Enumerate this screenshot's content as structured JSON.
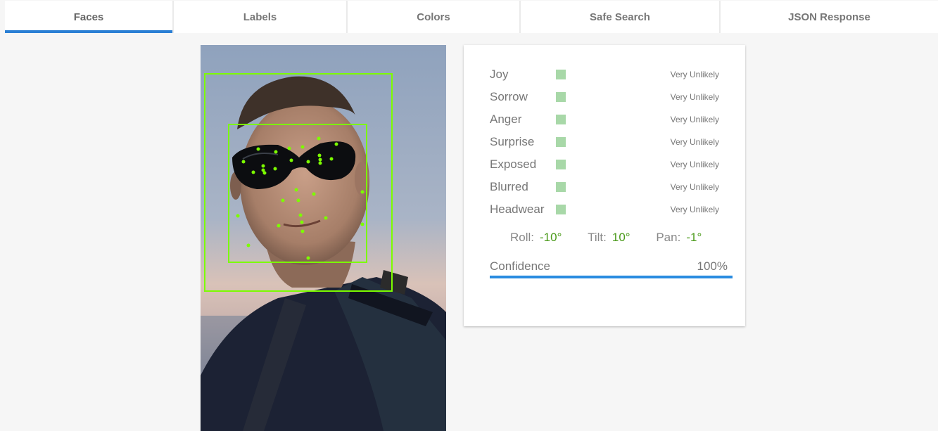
{
  "tabs": [
    {
      "label": "Faces",
      "active": true
    },
    {
      "label": "Labels",
      "active": false
    },
    {
      "label": "Colors",
      "active": false
    },
    {
      "label": "Safe Search",
      "active": false
    },
    {
      "label": "JSON Response",
      "active": false
    }
  ],
  "colors": {
    "accent": "#2a7fd4",
    "likelihood_square": "#a8d8a8",
    "landmark": "#7cfc00",
    "angle_value": "#4a9a1a"
  },
  "face_attributes": [
    {
      "label": "Joy",
      "likelihood": "Very Unlikely"
    },
    {
      "label": "Sorrow",
      "likelihood": "Very Unlikely"
    },
    {
      "label": "Anger",
      "likelihood": "Very Unlikely"
    },
    {
      "label": "Surprise",
      "likelihood": "Very Unlikely"
    },
    {
      "label": "Exposed",
      "likelihood": "Very Unlikely"
    },
    {
      "label": "Blurred",
      "likelihood": "Very Unlikely"
    },
    {
      "label": "Headwear",
      "likelihood": "Very Unlikely"
    }
  ],
  "angles": {
    "roll_label": "Roll:",
    "roll_value": "-10°",
    "tilt_label": "Tilt:",
    "tilt_value": "10°",
    "pan_label": "Pan:",
    "pan_value": "-1°"
  },
  "confidence": {
    "label": "Confidence",
    "value_text": "100%",
    "fraction": 1.0
  }
}
